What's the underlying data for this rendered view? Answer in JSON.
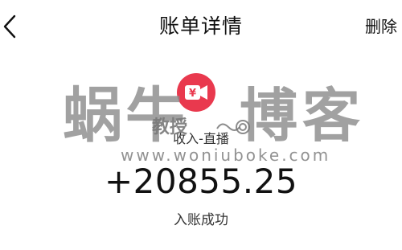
{
  "header": {
    "title": "账单详情",
    "delete_label": "删除",
    "back_icon": "chevron-left-icon"
  },
  "transaction": {
    "icon": "yuan-video-icon",
    "icon_color": "#e9394e",
    "category": "收入-直播",
    "amount": "+20855.25",
    "status": "入账成功"
  },
  "watermark": {
    "left_text": "蜗牛",
    "mid_text": "教授",
    "right_text": "博客",
    "url": "www.woniuboke.com"
  }
}
